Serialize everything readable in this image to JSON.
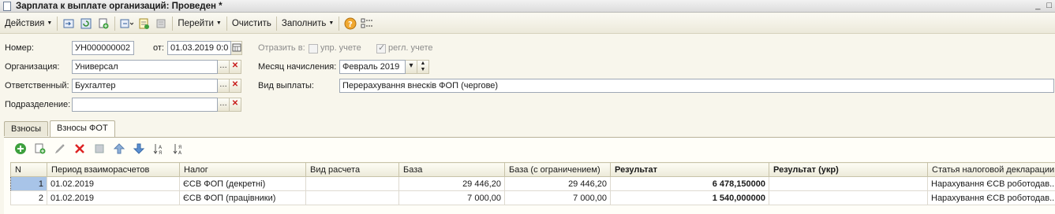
{
  "window": {
    "title": "Зарплата к выплате организаций: Проведен *",
    "min": "_",
    "max": "□"
  },
  "toolbar": {
    "actions": "Действия",
    "goto": "Перейти",
    "clear": "Очистить",
    "fill": "Заполнить"
  },
  "form": {
    "number_label": "Номер:",
    "number_value": "УН000000002",
    "date_label": "от:",
    "date_value": "01.03.2019 0:0",
    "reflect_label": "Отразить в:",
    "mgmt_label": "упр. учете",
    "mgmt_checked": false,
    "reg_label": "регл. учете",
    "reg_checked": true,
    "org_label": "Организация:",
    "org_value": "Универсал",
    "month_label": "Месяц начисления:",
    "month_value": "Февраль 2019",
    "resp_label": "Ответственный:",
    "resp_value": "Бухгалтер",
    "pay_type_label": "Вид выплаты:",
    "pay_type_value": "Перерахування внесків ФОП (чергове)",
    "dept_label": "Подразделение:",
    "dept_value": ""
  },
  "tabs": [
    {
      "label": "Взносы",
      "active": false
    },
    {
      "label": "Взносы ФОТ",
      "active": true
    }
  ],
  "grid": {
    "columns": [
      "N",
      "Период взаиморасчетов",
      "Налог",
      "Вид расчета",
      "База",
      "База (с ограничением)",
      "Результат",
      "Результат (укр)",
      "Статья налоговой декларации"
    ],
    "rows": [
      [
        "1",
        "01.02.2019",
        "ЄСВ ФОП (декретні)",
        "",
        "29 446,20",
        "29 446,20",
        "6 478,150000",
        "",
        "Нарахування ЄСВ роботодав..."
      ],
      [
        "2",
        "01.02.2019",
        "ЄСВ ФОП (працівники)",
        "",
        "7 000,00",
        "7 000,00",
        "1 540,000000",
        "",
        "Нарахування ЄСВ роботодав..."
      ]
    ]
  }
}
